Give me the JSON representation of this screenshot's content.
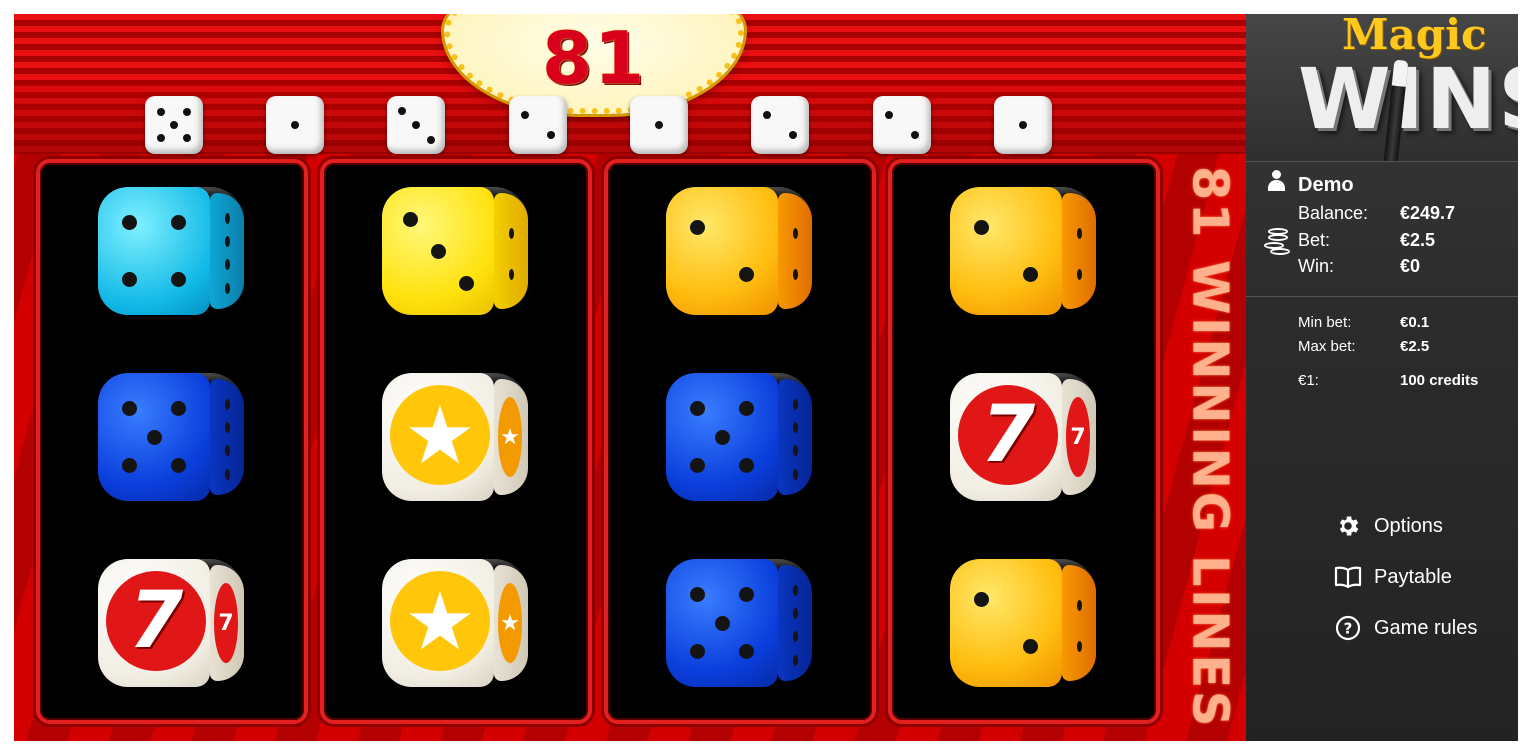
{
  "game": {
    "sign_number": "81",
    "side_banner": "81 WINNING LINES",
    "top_dice": [
      5,
      1,
      3,
      2,
      1,
      2,
      2,
      1
    ],
    "reels": [
      [
        {
          "color": "cyan",
          "symbol": "pips",
          "value": 4
        },
        {
          "color": "blue",
          "symbol": "pips",
          "value": 5
        },
        {
          "color": "white",
          "symbol": "seven"
        }
      ],
      [
        {
          "color": "yellow",
          "symbol": "pips",
          "value": 3
        },
        {
          "color": "white",
          "symbol": "star"
        },
        {
          "color": "white",
          "symbol": "star"
        }
      ],
      [
        {
          "color": "orange",
          "symbol": "pips",
          "value": 2
        },
        {
          "color": "blue",
          "symbol": "pips",
          "value": 5
        },
        {
          "color": "blue",
          "symbol": "pips",
          "value": 5
        }
      ],
      [
        {
          "color": "orange",
          "symbol": "pips",
          "value": 2
        },
        {
          "color": "white",
          "symbol": "seven"
        },
        {
          "color": "orange",
          "symbol": "pips",
          "value": 2
        }
      ]
    ],
    "seven_glyph": "7",
    "star_glyph": "★"
  },
  "panel": {
    "logo_top": "Magic",
    "logo_bottom": "WINS",
    "user_icon": "user-icon",
    "player_name": "Demo",
    "balance_label": "Balance:",
    "balance_value": "€249.7",
    "coins_icon": "coins-icon",
    "bet_label": "Bet:",
    "bet_value": "€2.5",
    "win_label": "Win:",
    "win_value": "€0",
    "min_bet_label": "Min bet:",
    "min_bet_value": "€0.1",
    "max_bet_label": "Max bet:",
    "max_bet_value": "€2.5",
    "rate_label": "€1:",
    "rate_value": "100 credits",
    "menu": [
      {
        "label": "Options",
        "icon": "gear-icon"
      },
      {
        "label": "Paytable",
        "icon": "book-icon"
      },
      {
        "label": "Game rules",
        "icon": "question-icon"
      }
    ]
  }
}
